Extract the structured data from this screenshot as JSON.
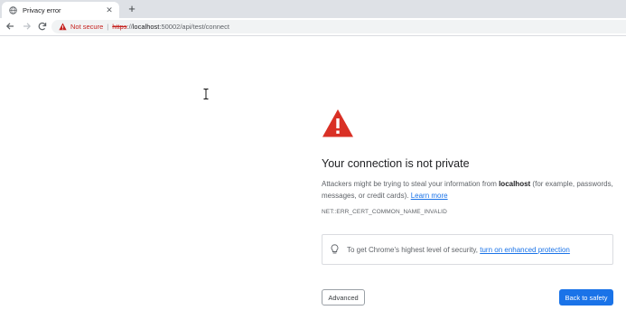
{
  "browser": {
    "tab": {
      "title": "Privacy error",
      "icon": "globe-icon",
      "close_glyph": "✕"
    },
    "new_tab_glyph": "+",
    "address_bar": {
      "security_label": "Not secure",
      "separator": "|",
      "scheme": "https",
      "scheme_suffix": "://",
      "host": "localhost",
      "port_path": ":50002/api/test/connect"
    }
  },
  "interstitial": {
    "heading": "Your connection is not private",
    "desc_pre": "Attackers might be trying to steal your information from ",
    "desc_host": "localhost",
    "desc_post": " (for example, passwords, messages, or credit cards). ",
    "learn_more": "Learn more",
    "error_code": "NET::ERR_CERT_COMMON_NAME_INVALID",
    "enhanced_protection": {
      "text": "To get Chrome's highest level of security, ",
      "link": "turn on enhanced protection"
    },
    "advanced_button": "Advanced",
    "back_button": "Back to safety"
  },
  "colors": {
    "accent": "#1a73e8",
    "warning_red": "#d93025",
    "not_secure_red": "#c5221f"
  }
}
